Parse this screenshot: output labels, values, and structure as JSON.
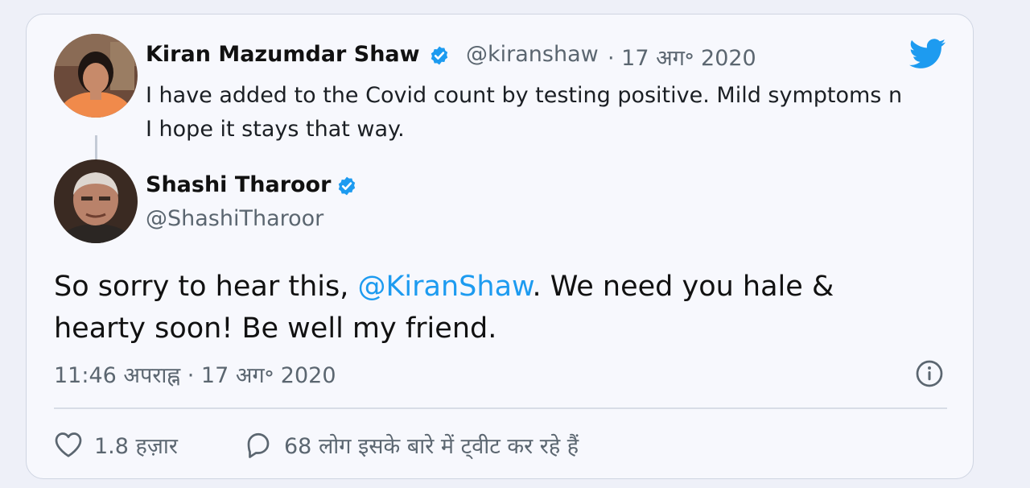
{
  "quoted_tweet": {
    "author_name": "Kiran Mazumdar Shaw",
    "handle": "@kiranshaw",
    "date": "· 17 अग॰ 2020",
    "text_lines": [
      "I have added to the Covid count by testing positive.  Mild symptoms n",
      "I hope it stays that way."
    ]
  },
  "tweet": {
    "author_name": "Shashi Tharoor",
    "handle": "@ShashiTharoor",
    "text_before": "So sorry to hear this, ",
    "mention": "@KiranShaw",
    "text_after": ". We need you hale &",
    "text_line2": "hearty soon! Be well my friend.",
    "timestamp": "11:46 अपराह्न · 17 अग॰ 2020"
  },
  "actions": {
    "likes": "1.8 हज़ार",
    "replies": "68 लोग इसके बारे में ट्वीट कर रहे हैं"
  },
  "colors": {
    "twitter_blue": "#1d9bf0",
    "muted_text": "#5b6670",
    "card_bg": "#f7f8fd",
    "border": "#cfd5e2"
  },
  "icons": [
    "verified-badge-icon",
    "twitter-bird-icon",
    "info-icon",
    "heart-icon",
    "reply-bubble-icon"
  ]
}
